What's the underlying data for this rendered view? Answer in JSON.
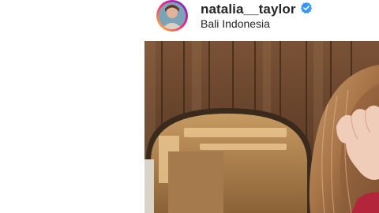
{
  "post": {
    "username": "natalia__taylor",
    "location": "Bali Indonesia",
    "verified": true,
    "icons": {
      "avatar": "profile-avatar",
      "verified": "verified-badge-icon"
    },
    "colors": {
      "verified_blue": "#3897f0",
      "text": "#262626"
    }
  }
}
